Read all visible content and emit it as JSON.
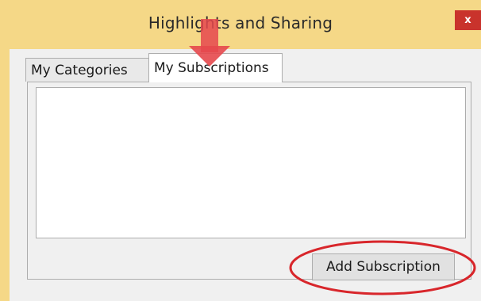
{
  "window": {
    "title": "Highlights and Sharing",
    "close_label": "x",
    "close_color": "#c9332c",
    "titlebar_color": "#f5d887"
  },
  "tabs": [
    {
      "label": "My Categories",
      "selected": false
    },
    {
      "label": "My Subscriptions",
      "selected": true
    }
  ],
  "subscriptions_list": [],
  "buttons": {
    "add_subscription": "Add Subscription"
  },
  "annotations": {
    "arrow": {
      "icon": "down-arrow-icon",
      "color": "#e5484d",
      "points_to": "My Subscriptions tab"
    },
    "ellipse": {
      "color": "#d8262b",
      "highlights": "Add Subscription button"
    }
  }
}
